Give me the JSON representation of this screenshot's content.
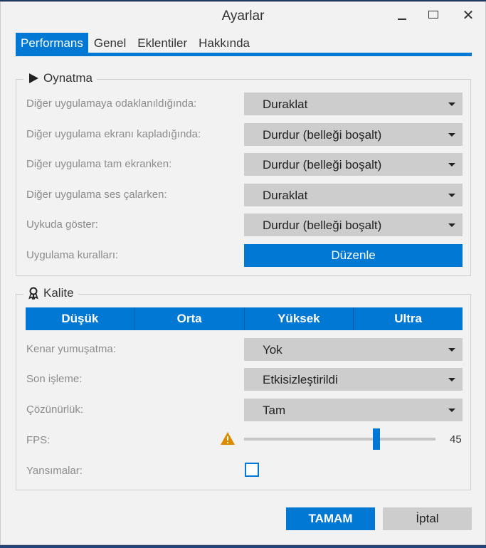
{
  "window": {
    "title": "Ayarlar"
  },
  "tabs": [
    {
      "label": "Performans"
    },
    {
      "label": "Genel"
    },
    {
      "label": "Eklentiler"
    },
    {
      "label": "Hakkında"
    }
  ],
  "playback": {
    "title": "Oynatma",
    "rows": [
      {
        "label": "Diğer uygulamaya odaklanıldığında:",
        "value": "Duraklat"
      },
      {
        "label": "Diğer uygulama ekranı kapladığında:",
        "value": "Durdur (belleği boşalt)"
      },
      {
        "label": "Diğer uygulama tam ekranken:",
        "value": "Durdur (belleği boşalt)"
      },
      {
        "label": "Diğer uygulama ses çalarken:",
        "value": "Duraklat"
      },
      {
        "label": "Uykuda göster:",
        "value": "Durdur (belleği boşalt)"
      }
    ],
    "rules_label": "Uygulama kuralları:",
    "rules_button": "Düzenle"
  },
  "quality": {
    "title": "Kalite",
    "presets": [
      "Düşük",
      "Orta",
      "Yüksek",
      "Ultra"
    ],
    "antialias_label": "Kenar yumuşatma:",
    "antialias_value": "Yok",
    "postproc_label": "Son işleme:",
    "postproc_value": "Etkisizleştirildi",
    "resolution_label": "Çözünürlük:",
    "resolution_value": "Tam",
    "fps_label": "FPS:",
    "fps_value": "45",
    "reflections_label": "Yansımalar:",
    "reflections_checked": false
  },
  "footer": {
    "ok": "TAMAM",
    "cancel": "İptal"
  },
  "colors": {
    "accent": "#0078d4",
    "warning": "#e08a00"
  }
}
